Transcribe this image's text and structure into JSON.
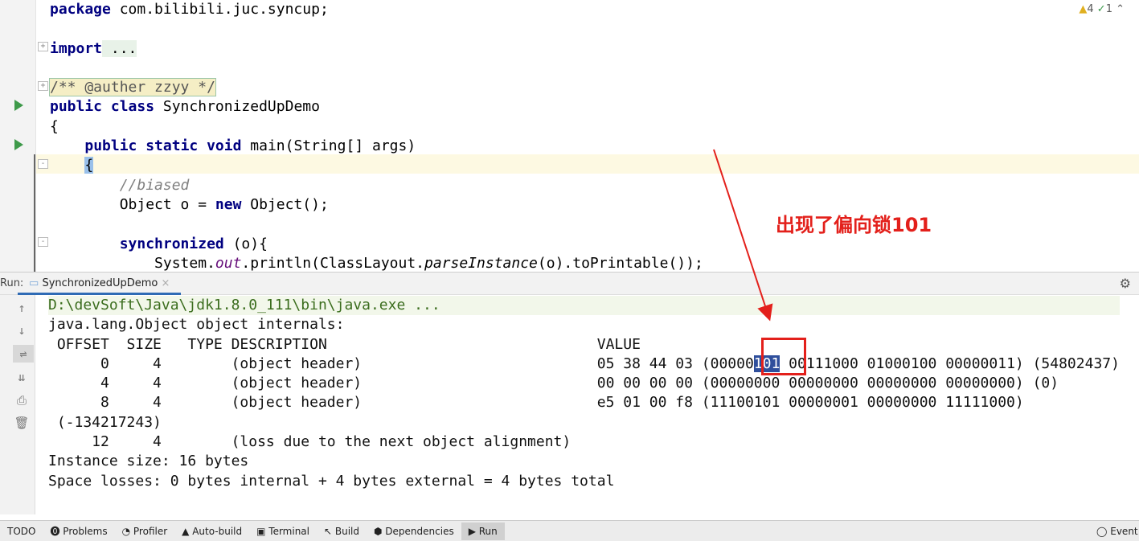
{
  "editor": {
    "inspections": {
      "warnings": "4",
      "ok": "1"
    },
    "lines": [
      {
        "pre": "",
        "kw": "package",
        "rest": " com.bilibili.juc.syncup;"
      },
      {
        "kw": "import",
        "rest": " ..."
      },
      {
        "doc": "/** @auther zzyy */"
      },
      {
        "kw": "public class",
        "rest": " SynchronizedUpDemo"
      },
      {
        "rest": "{"
      },
      {
        "kw": "public static void",
        "rest": " main(String[] args)"
      },
      {
        "rest": "{"
      },
      {
        "comment": "//biased"
      },
      {
        "pre": "Object o = ",
        "kw": "new",
        "rest": " Object();"
      },
      {
        "kw": "synchronized",
        "rest": " (o){"
      },
      {
        "pre": "System.",
        "it": "out",
        "mid": ".println(ClassLayout.",
        "it2": "parseInstance",
        "rest": "(o).toPrintable());"
      }
    ]
  },
  "run_panel": {
    "label": "Run:",
    "tab": "SynchronizedUpDemo",
    "tab_close": "×"
  },
  "console": {
    "cmd": "D:\\devSoft\\Java\\jdk1.8.0_111\\bin\\java.exe ...",
    "title": "java.lang.Object object internals:",
    "header": " OFFSET  SIZE   TYPE DESCRIPTION                               VALUE",
    "row0_pre": "      0     4        (object header)                           05 38 44 03 (00000",
    "row0_hl": "101",
    "row0_post": " 00111000 01000100 00000011) (54802437)",
    "row1": "      4     4        (object header)                           00 00 00 00 (00000000 00000000 00000000 00000000) (0)",
    "row2": "      8     4        (object header)                           e5 01 00 f8 (11100101 00000001 00000000 11111000)",
    "row2_wrap": " (-134217243)",
    "row3": "     12     4        (loss due to the next object alignment)",
    "instance_size": "Instance size: 16 bytes",
    "space_losses": "Space losses: 0 bytes internal + 4 bytes external = 4 bytes total"
  },
  "annotation": {
    "text": "出现了偏向锁101",
    "color": "#e3201b"
  },
  "statusbar": {
    "items": [
      "TODO",
      "Problems",
      "Profiler",
      "Auto-build",
      "Terminal",
      "Build",
      "Dependencies",
      "Run"
    ],
    "right": "Event Log"
  }
}
